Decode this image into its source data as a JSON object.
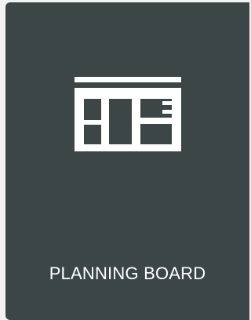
{
  "tile": {
    "label": "PLANNING BOARD",
    "icon": "planning-board-icon",
    "background_color": "#3c4647",
    "foreground_color": "#ffffff"
  }
}
